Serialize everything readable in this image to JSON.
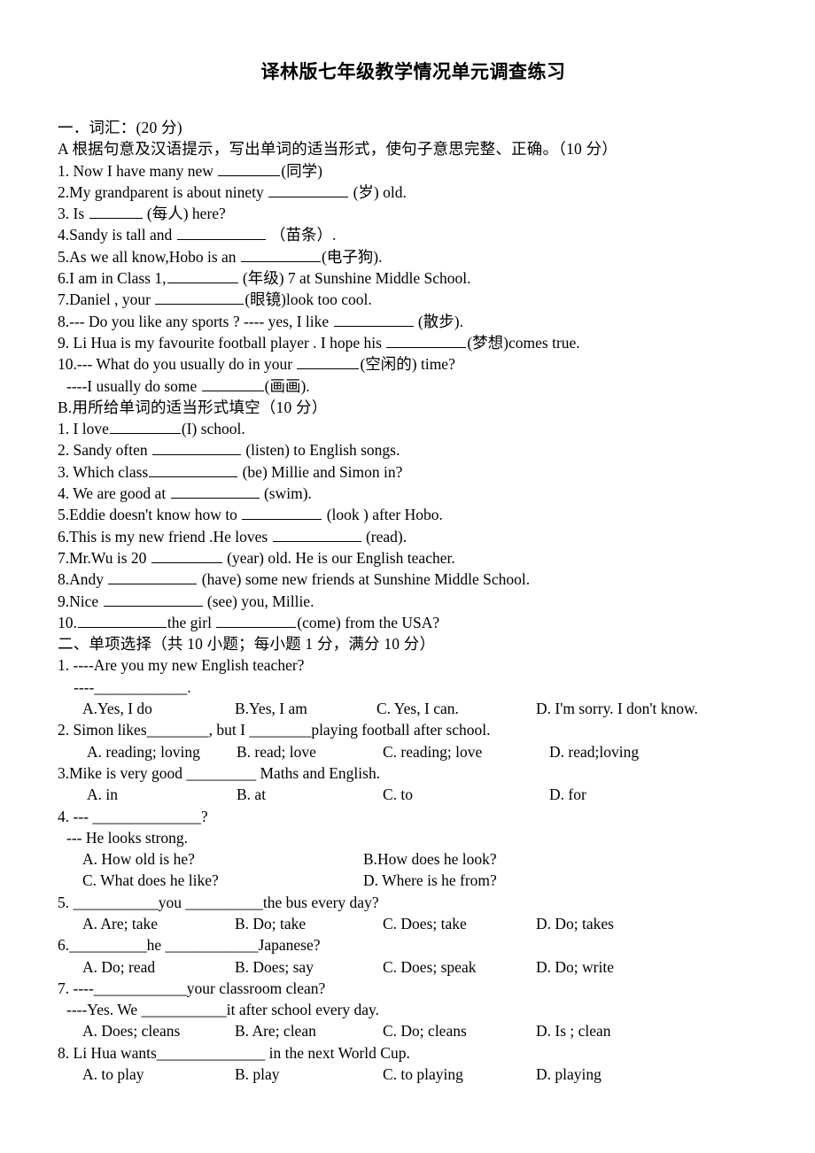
{
  "document": {
    "title": "译林版七年级教学情况单元调查练习"
  },
  "section_one": {
    "heading": "一．词汇：(20 分)",
    "part_a_heading": "A 根据句意及汉语提示，写出单词的适当形式，使句子意思完整、正确。（10 分）",
    "part_a_items": [
      {
        "num": "1.",
        "before": "Now I have many new",
        "blank": "b7",
        "after": "(同学)"
      },
      {
        "num": "2.",
        "before": "My grandparent is about ninety",
        "blank": "b9",
        "after": "(岁) old."
      },
      {
        "num": "3.",
        "before": "Is",
        "blank": "b6",
        "after": "(每人) here?"
      },
      {
        "num": "4.",
        "before": "Sandy is tall and",
        "blank": "b10",
        "after": "（苗条）."
      },
      {
        "num": "5.",
        "before": "As we all know,Hobo is an",
        "blank": "b9",
        "after": "(电子狗)."
      },
      {
        "num": "6.",
        "before": "I am in Class 1,",
        "blank": "b8",
        "after": "(年级) 7 at Sunshine Middle School."
      },
      {
        "num": "7.",
        "before": "Daniel , your",
        "blank": "b10",
        "after": "(眼镜)look too cool."
      },
      {
        "num": "8.",
        "before": "--- Do you like any sports ? ---- yes, I like",
        "blank": "b9",
        "after": "(散步)."
      },
      {
        "num": "9.",
        "before": "Li Hua is my favourite football player . I hope his",
        "blank": "b9",
        "after": "(梦想)comes true."
      },
      {
        "num": "10.",
        "before": "--- What do you usually do in your",
        "blank": "b7",
        "after": "(空闲的) time?"
      },
      {
        "num": "",
        "before": "----I usually do some",
        "blank": "b7",
        "after": "(画画)."
      }
    ],
    "part_b_heading": "B.用所给单词的适当形式填空（10 分）",
    "part_b_items": [
      {
        "num": "1.",
        "before": "I love",
        "blank": "b8",
        "after": "(I) school."
      },
      {
        "num": "2.",
        "before": "Sandy often",
        "blank": "b10",
        "after": "(listen) to English songs."
      },
      {
        "num": "3.",
        "before": "Which class",
        "blank": "b10",
        "after": "(be) Millie and Simon in?"
      },
      {
        "num": "4.",
        "before": "We are good at",
        "blank": "b10",
        "after": "(swim)."
      },
      {
        "num": "5.",
        "before": "Eddie doesn't know how to",
        "blank": "b9",
        "after": "(look ) after Hobo."
      },
      {
        "num": "6.",
        "before": "This is my new friend .He loves",
        "blank": "b10",
        "after": "(read)."
      },
      {
        "num": "7.",
        "before": "Mr.Wu is 20",
        "blank": "b8",
        "after": "(year) old. He is our English teacher."
      },
      {
        "num": "8.",
        "before": "Andy",
        "blank": "b10",
        "after": "(have) some new friends at Sunshine Middle School."
      },
      {
        "num": "9.",
        "before": "Nice",
        "blank": "b11",
        "after": "(see) you, Millie."
      },
      {
        "num": "10.",
        "before": "",
        "blank": "b10",
        "mid": "the girl",
        "blank2": "b9",
        "after": "(come) from the USA?"
      }
    ]
  },
  "section_two": {
    "heading": "二、单项选择（共 10 小题；每小题 1 分，满分 10 分）",
    "questions": [
      {
        "stem_lines": [
          "1. ----Are you my new English teacher?",
          "----____________."
        ],
        "options": [
          "A.Yes, I do",
          "B.Yes, I am",
          "C. Yes, I can.",
          "D. I'm sorry. I don't know."
        ]
      },
      {
        "stem_lines": [
          "2. Simon likes________, but I ________playing football after school."
        ],
        "options": [
          "A. reading; loving",
          "B. read; love",
          "C. reading; love",
          "D. read;loving"
        ]
      },
      {
        "stem_lines": [
          "3.Mike is very good _________ Maths and English."
        ],
        "options": [
          "A. in",
          "B. at",
          "C. to",
          "D. for"
        ]
      },
      {
        "stem_lines": [
          "4. --- ______________?",
          "--- He looks strong."
        ],
        "options": [
          "A.  How old is he?",
          "B.How does he look?",
          "C. What does he like?",
          "D. Where is he from?"
        ]
      },
      {
        "stem_lines": [
          "5. ___________you __________the bus every day?"
        ],
        "options": [
          "A. Are; take",
          "B. Do; take",
          "C. Does; take",
          "D. Do; takes"
        ]
      },
      {
        "stem_lines": [
          "6.__________he ____________Japanese?"
        ],
        "options": [
          "A. Do; read",
          "B. Does; say",
          "C. Does; speak",
          "D. Do; write"
        ]
      },
      {
        "stem_lines": [
          "7. ----____________your classroom clean?",
          "----Yes.   We ___________it after school every day."
        ],
        "options": [
          "A. Does; cleans",
          "B. Are; clean",
          "C. Do; cleans",
          "D. Is ; clean"
        ]
      },
      {
        "stem_lines": [
          "8.   Li Hua wants______________ in the next World Cup."
        ],
        "options": [
          "A. to play",
          "B. play",
          "C. to playing",
          "D. playing"
        ]
      }
    ]
  }
}
